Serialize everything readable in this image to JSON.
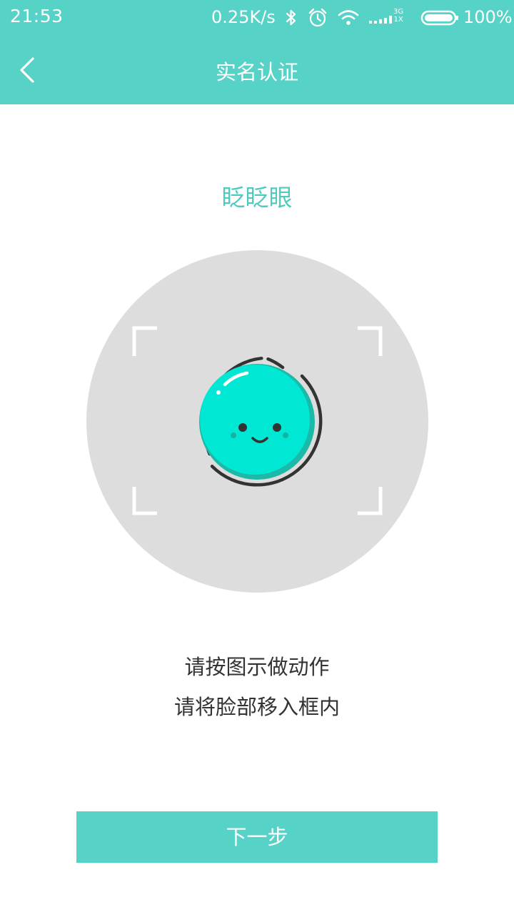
{
  "status_bar": {
    "time": "21:53",
    "speed": "0.25K/s",
    "network_type": "3G",
    "network_sub": "1X",
    "battery": "100%",
    "icons": [
      "bluetooth-icon",
      "alarm-icon",
      "wifi-icon",
      "signal-icon",
      "battery-icon"
    ]
  },
  "header": {
    "title": "实名认证",
    "back_icon": "chevron-left-icon",
    "background_color": "#56d2c6"
  },
  "action": {
    "title": "眨眨眼",
    "title_color": "#4fcabd"
  },
  "scan_area": {
    "circle_color": "#dddddd",
    "face_color": "#00e8d4",
    "icons": [
      "face-frame-corners",
      "smiley-face-icon"
    ]
  },
  "instructions": {
    "line1": "请按图示做动作",
    "line2": "请将脸部移入框内"
  },
  "next_button": {
    "label": "下一步",
    "color": "#56d2c6"
  }
}
